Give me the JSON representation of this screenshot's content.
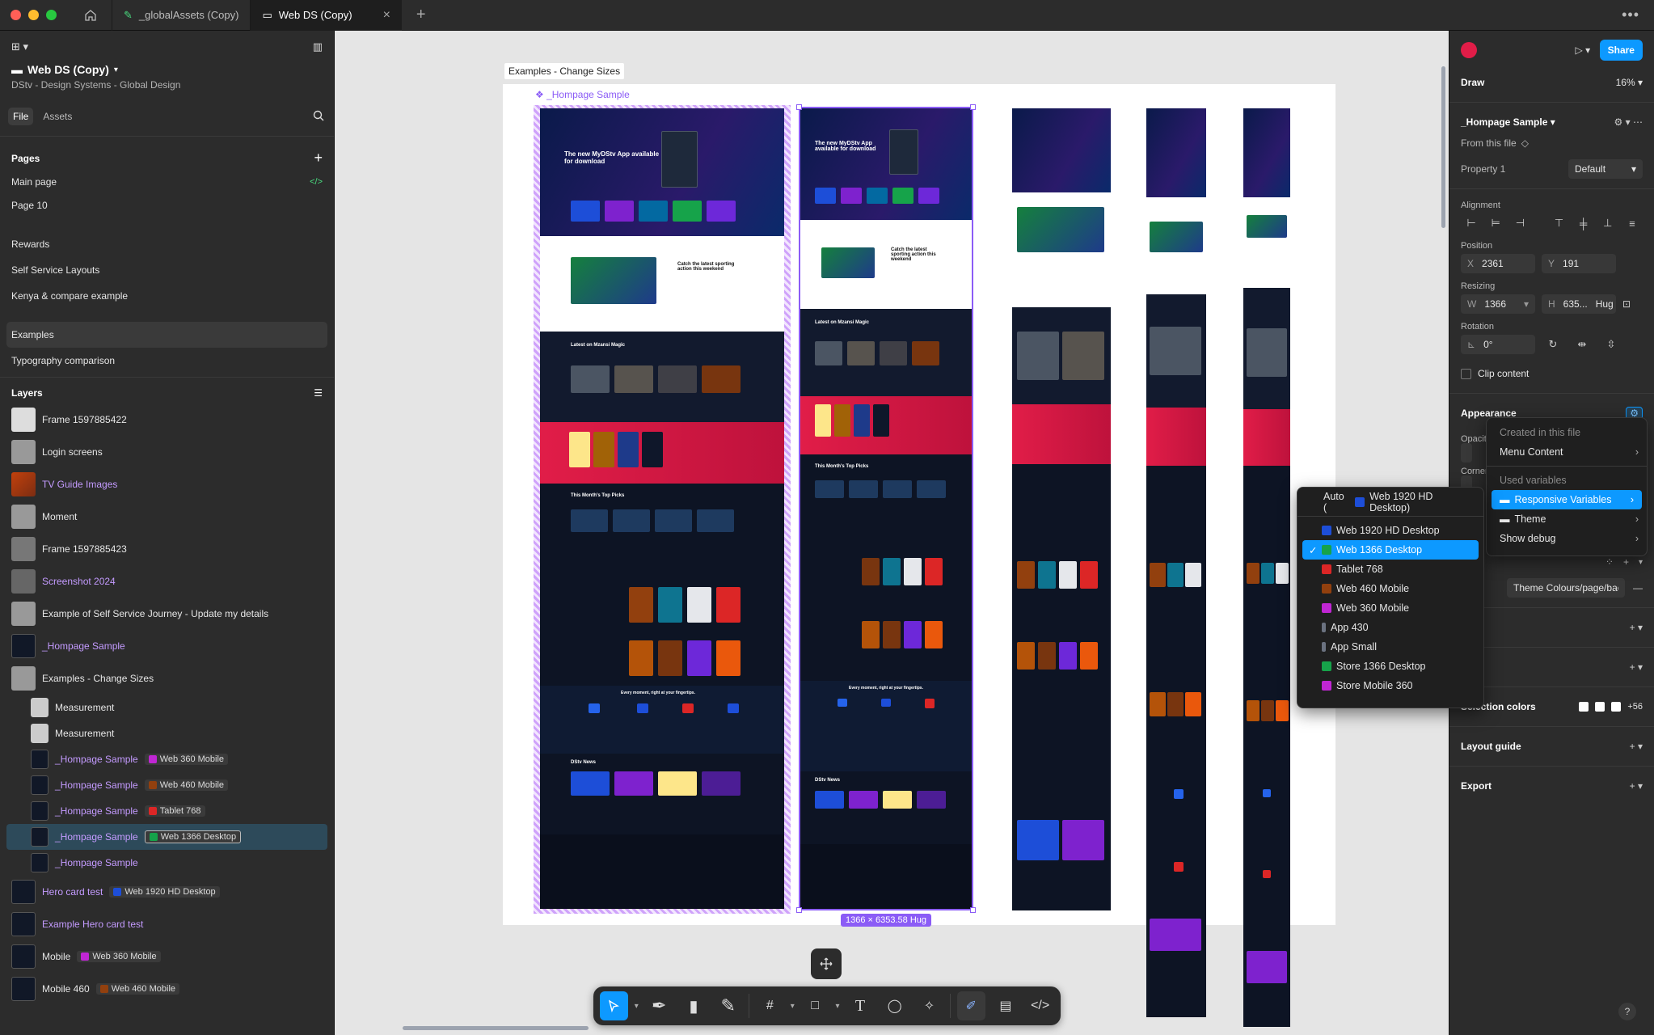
{
  "tabs": [
    {
      "label": "_globalAssets (Copy)"
    },
    {
      "label": "Web DS (Copy)"
    }
  ],
  "file": {
    "name": "Web DS (Copy)",
    "subtitle": "DStv - Design Systems - Global Design",
    "tab_file": "File",
    "tab_assets": "Assets"
  },
  "pages": {
    "heading": "Pages",
    "items": [
      "Main page",
      "Page 10",
      "Rewards",
      "Self Service Layouts",
      "Kenya & compare example",
      "Examples",
      "Typography comparison"
    ]
  },
  "layers": {
    "heading": "Layers",
    "items": [
      {
        "label": "Frame 1597885422"
      },
      {
        "label": "Login screens"
      },
      {
        "label": "TV Guide Images"
      },
      {
        "label": "Moment"
      },
      {
        "label": "Frame 1597885423"
      },
      {
        "label": "Screenshot 2024"
      },
      {
        "label": "Example of Self Service Journey - Update my details"
      },
      {
        "label": "_Hompage Sample"
      },
      {
        "label": "Examples - Change Sizes"
      },
      {
        "label": "Measurement"
      },
      {
        "label": "Measurement"
      },
      {
        "label": "_Hompage Sample",
        "chip": "Web 360 Mobile"
      },
      {
        "label": "_Hompage Sample",
        "chip": "Web 460 Mobile"
      },
      {
        "label": "_Hompage Sample",
        "chip": "Tablet 768"
      },
      {
        "label": "_Hompage Sample",
        "chip": "Web 1366 Desktop"
      },
      {
        "label": "_Hompage Sample"
      },
      {
        "label": "Hero card test",
        "chip": "Web 1920 HD Desktop"
      },
      {
        "label": "Example Hero card test"
      },
      {
        "label": "Mobile",
        "chip": "Web 360 Mobile"
      },
      {
        "label": "Mobile 460",
        "chip": "Web 460 Mobile"
      }
    ]
  },
  "canvas": {
    "frame_label": "Examples - Change Sizes",
    "component_label": "_Hompage Sample",
    "size_label": "1366 × 6353.58 Hug",
    "hero_title": "The new MyDStv App available for download",
    "sport_title": "Catch the latest sporting action this weekend",
    "section_mzansi": "Latest on Mzansi Magic",
    "section_picks": "This Month's Top Picks",
    "section_every": "Every moment, right at your fingertips.",
    "section_news": "DStv News"
  },
  "right": {
    "draw_label": "Draw",
    "zoom": "16%",
    "share_label": "Share",
    "component_name": "_Hompage Sample",
    "from_file": "From this file",
    "property_label": "Property 1",
    "property_value": "Default",
    "alignment": "Alignment",
    "position": "Position",
    "x_label": "X",
    "x_value": "2361",
    "y_label": "Y",
    "y_value": "191",
    "resizing": "Resizing",
    "w_label": "W",
    "w_value": "1366",
    "h_label": "H",
    "h_value": "635...",
    "hug": "Hug",
    "rotation": "Rotation",
    "rotation_value": "0°",
    "clip_content": "Clip content",
    "appearance": "Appearance",
    "opacity_partial": "Opacit",
    "corner_partial": "Corner",
    "fill_partial": "F",
    "fill_value": "Theme Colours/page/bac...",
    "stroke_partial": "ke",
    "effects_partial": "cts",
    "selection_colors": "Selection colors",
    "selection_more": "+56",
    "layout_guide": "Layout guide",
    "export": "Export"
  },
  "mode_menu": {
    "items": [
      {
        "label": "Auto (",
        "extra": "Web 1920 HD Desktop)",
        "color": "#1d4ed8"
      },
      {
        "label": "Web 1920 HD Desktop",
        "color": "#1d4ed8"
      },
      {
        "label": "Web 1366 Desktop",
        "color": "#16a34a",
        "selected": true
      },
      {
        "label": "Tablet 768",
        "color": "#dc2626"
      },
      {
        "label": "Web 460 Mobile",
        "color": "#92400e"
      },
      {
        "label": "Web 360 Mobile",
        "color": "#c026d3"
      },
      {
        "label": "App 430",
        "color": "#6b7280"
      },
      {
        "label": "App Small",
        "color": "#6b7280"
      },
      {
        "label": "Store 1366 Desktop",
        "color": "#16a34a"
      },
      {
        "label": "Store Mobile 360",
        "color": "#c026d3"
      }
    ]
  },
  "var_menu": {
    "created_heading": "Created in this file",
    "menu_content": "Menu Content",
    "used_heading": "Used variables",
    "responsive": "Responsive Variables",
    "theme": "Theme",
    "show_debug": "Show debug"
  },
  "colors": {
    "accent": "#0d99ff",
    "component": "#8b5cf6",
    "selection_layer": "#2d4a5a"
  }
}
